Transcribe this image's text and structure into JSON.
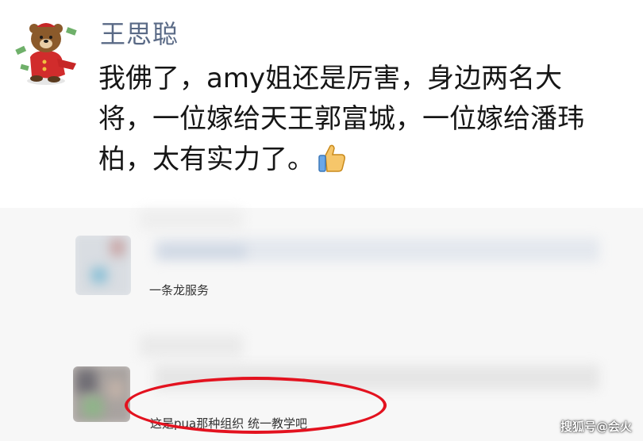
{
  "post": {
    "author": "王思聪",
    "avatar_icon": "cartoon-bear-avatar-icon",
    "line1": "我佛了，amy姐还是厉害，身边两名大",
    "line2": "将，一位嫁给天王郭富城，一位嫁给潘玮",
    "line3": "柏，太有实力了。",
    "emoji_icon": "thumbs-up-icon"
  },
  "comments": [
    {
      "text": "一条龙服务"
    },
    {
      "text": "这是pua那种组织 统一教学吧"
    }
  ],
  "colors": {
    "author_name": "#5a6a86",
    "highlight": "#e3121f",
    "comment_bg": "#f7f7f7"
  },
  "watermark": "搜狐号@会火"
}
